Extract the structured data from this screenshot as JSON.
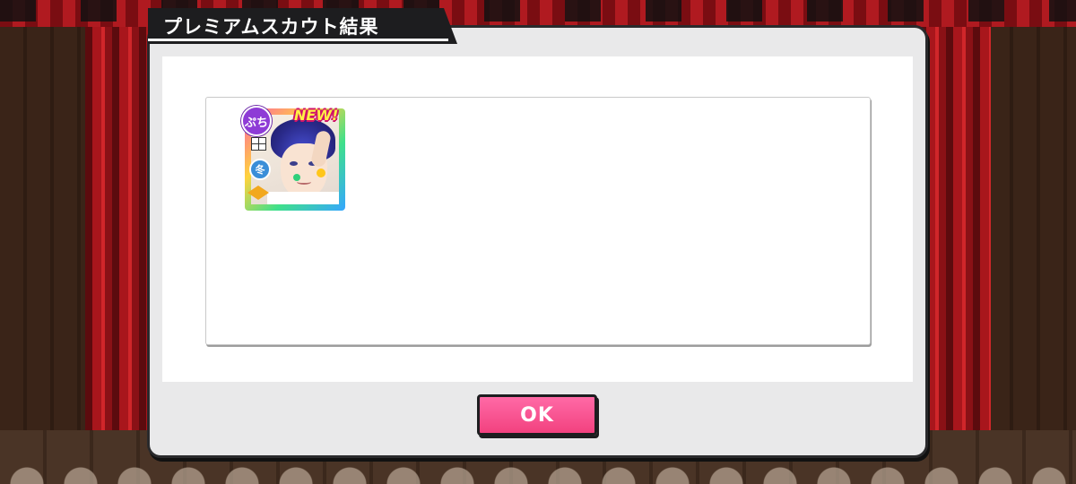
{
  "dialog": {
    "title": "プレミアムスカウト結果",
    "ok_label": "OK"
  },
  "result_card": {
    "type_badge": "ぷち",
    "new_badge": "NEW!",
    "season_badge": "冬",
    "icons": [
      "grid-icon",
      "rarity-icon"
    ]
  },
  "colors": {
    "accent": "#f2417f",
    "title_bar": "#1d1d1f",
    "curtain": "#a8161c"
  }
}
